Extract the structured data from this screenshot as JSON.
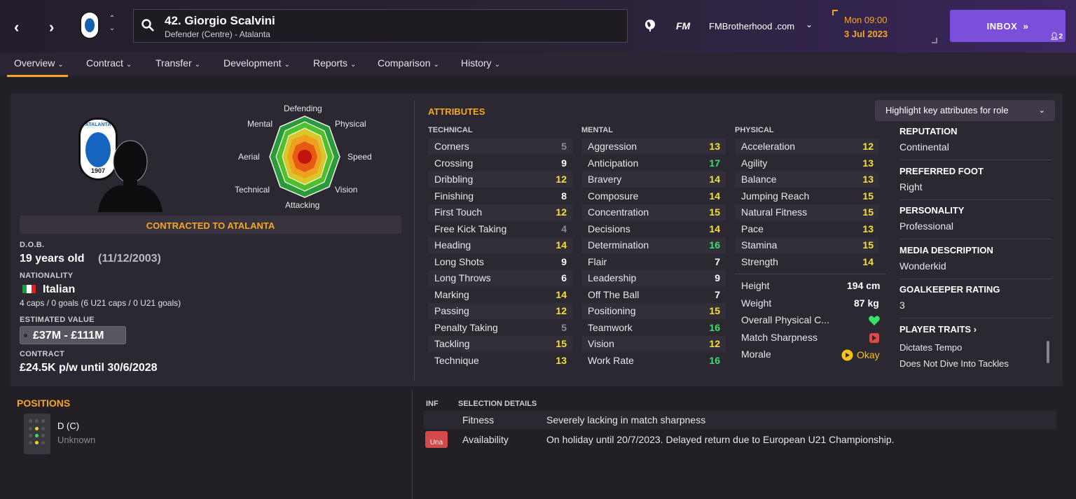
{
  "header": {
    "player_name": "42. Giorgio Scalvini",
    "player_sub": "Defender (Centre) - Atalanta",
    "site": "FMBrotherhood .com",
    "fm_logo": "FM",
    "day_time": "Mon 09:00",
    "date": "3 Jul 2023",
    "inbox_label": "INBOX",
    "inbox_arrows": "»",
    "inbox_badge": "2"
  },
  "tabs": [
    {
      "label": "Overview"
    },
    {
      "label": "Contract"
    },
    {
      "label": "Transfer"
    },
    {
      "label": "Development"
    },
    {
      "label": "Reports"
    },
    {
      "label": "Comparison"
    },
    {
      "label": "History"
    }
  ],
  "radar_labels": {
    "defending": "Defending",
    "mental": "Mental",
    "physical": "Physical",
    "aerial": "Aerial",
    "speed": "Speed",
    "technical": "Technical",
    "vision": "Vision",
    "attacking": "Attacking"
  },
  "crest_text": {
    "top": "ATALANTA",
    "year": "1907"
  },
  "profile": {
    "contract_banner": "CONTRACTED TO ATALANTA",
    "dob_label": "D.O.B.",
    "age": "19 years old",
    "dob": "(11/12/2003)",
    "nationality_label": "NATIONALITY",
    "nationality": "Italian",
    "caps": "4 caps / 0 goals (6 U21 caps / 0 U21 goals)",
    "value_label": "ESTIMATED VALUE",
    "value": "£37M - £111M",
    "contract_label": "CONTRACT",
    "contract": "£24.5K p/w until 30/6/2028"
  },
  "attributes": {
    "title": "ATTRIBUTES",
    "highlight_button": "Highlight key attributes for role",
    "technical_head": "TECHNICAL",
    "mental_head": "MENTAL",
    "physical_head": "PHYSICAL",
    "technical": [
      {
        "name": "Corners",
        "value": "5",
        "color": "grey"
      },
      {
        "name": "Crossing",
        "value": "9",
        "color": "white"
      },
      {
        "name": "Dribbling",
        "value": "12",
        "color": "yellow"
      },
      {
        "name": "Finishing",
        "value": "8",
        "color": "white"
      },
      {
        "name": "First Touch",
        "value": "12",
        "color": "yellow"
      },
      {
        "name": "Free Kick Taking",
        "value": "4",
        "color": "grey"
      },
      {
        "name": "Heading",
        "value": "14",
        "color": "yellow"
      },
      {
        "name": "Long Shots",
        "value": "9",
        "color": "white"
      },
      {
        "name": "Long Throws",
        "value": "6",
        "color": "white"
      },
      {
        "name": "Marking",
        "value": "14",
        "color": "yellow"
      },
      {
        "name": "Passing",
        "value": "12",
        "color": "yellow"
      },
      {
        "name": "Penalty Taking",
        "value": "5",
        "color": "grey"
      },
      {
        "name": "Tackling",
        "value": "15",
        "color": "yellow"
      },
      {
        "name": "Technique",
        "value": "13",
        "color": "yellow"
      }
    ],
    "mental": [
      {
        "name": "Aggression",
        "value": "13",
        "color": "yellow"
      },
      {
        "name": "Anticipation",
        "value": "17",
        "color": "green"
      },
      {
        "name": "Bravery",
        "value": "14",
        "color": "yellow"
      },
      {
        "name": "Composure",
        "value": "14",
        "color": "yellow"
      },
      {
        "name": "Concentration",
        "value": "15",
        "color": "yellow"
      },
      {
        "name": "Decisions",
        "value": "14",
        "color": "yellow"
      },
      {
        "name": "Determination",
        "value": "16",
        "color": "green"
      },
      {
        "name": "Flair",
        "value": "7",
        "color": "white"
      },
      {
        "name": "Leadership",
        "value": "9",
        "color": "white"
      },
      {
        "name": "Off The Ball",
        "value": "7",
        "color": "white"
      },
      {
        "name": "Positioning",
        "value": "15",
        "color": "yellow"
      },
      {
        "name": "Teamwork",
        "value": "16",
        "color": "green"
      },
      {
        "name": "Vision",
        "value": "12",
        "color": "yellow"
      },
      {
        "name": "Work Rate",
        "value": "16",
        "color": "green"
      }
    ],
    "physical": [
      {
        "name": "Acceleration",
        "value": "12",
        "color": "yellow"
      },
      {
        "name": "Agility",
        "value": "13",
        "color": "yellow"
      },
      {
        "name": "Balance",
        "value": "13",
        "color": "yellow"
      },
      {
        "name": "Jumping Reach",
        "value": "15",
        "color": "yellow"
      },
      {
        "name": "Natural Fitness",
        "value": "15",
        "color": "yellow"
      },
      {
        "name": "Pace",
        "value": "13",
        "color": "yellow"
      },
      {
        "name": "Stamina",
        "value": "15",
        "color": "yellow"
      },
      {
        "name": "Strength",
        "value": "14",
        "color": "yellow"
      }
    ],
    "extras": {
      "height_label": "Height",
      "height": "194 cm",
      "weight_label": "Weight",
      "weight": "87 kg",
      "overall_label": "Overall Physical C...",
      "sharpness_label": "Match Sharpness",
      "morale_label": "Morale",
      "morale": "Okay"
    }
  },
  "info": {
    "reputation_label": "REPUTATION",
    "reputation": "Continental",
    "foot_label": "PREFERRED FOOT",
    "foot": "Right",
    "personality_label": "PERSONALITY",
    "personality": "Professional",
    "media_label": "MEDIA DESCRIPTION",
    "media": "Wonderkid",
    "gk_label": "GOALKEEPER RATING",
    "gk": "3",
    "traits_label": "PLAYER TRAITS",
    "traits_arrow": "›",
    "traits": [
      "Dictates Tempo",
      "Does Not Dive Into Tackles"
    ]
  },
  "positions": {
    "title": "POSITIONS",
    "position": "D (C)",
    "familiarity": "Unknown"
  },
  "selection": {
    "inf_head": "INF",
    "details_head": "SELECTION DETAILS",
    "rows": [
      {
        "label": "Fitness",
        "detail": "Severely lacking in match sharpness"
      },
      {
        "label": "Availability",
        "detail": "On holiday until 20/7/2023. Delayed return due to European U21 Championship.",
        "badge": "Una"
      }
    ]
  },
  "colors": {
    "accent": "#f5a623",
    "inbox": "#7b4fd9",
    "attr_grey": "#8f8a96",
    "attr_yellow": "#f5e03a",
    "attr_green": "#3be06a",
    "unavailable": "#d24a4a"
  }
}
